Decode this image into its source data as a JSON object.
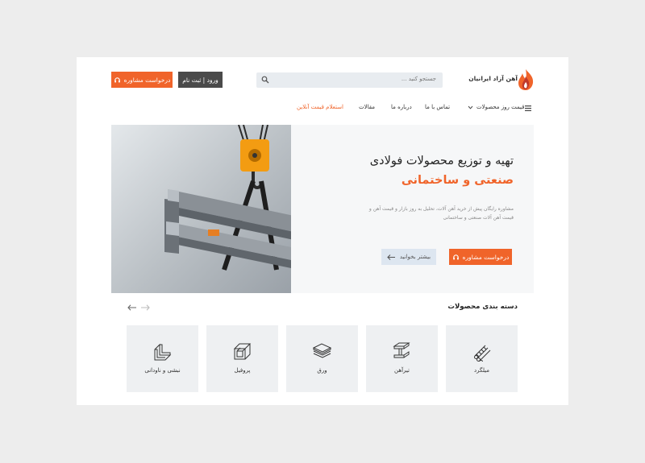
{
  "header": {
    "consult_button": "درخواست مشاوره",
    "login_button": "ورود | ثبت نام",
    "search_placeholder": "جستجو کنید ...",
    "brand": "آهن آزاد ایرانیان"
  },
  "nav": {
    "items": [
      "قیمت روز محصولات",
      "تماس با ما",
      "درباره ما",
      "مقالات",
      "استعلام قیمت آنلاین"
    ]
  },
  "hero": {
    "title_line1": "تهیه و توزیع محصولات فولادی",
    "title_line2": "صنعتی و ساختمانی",
    "description": "مشاوره رایگان پیش از خرید آهن آلات، تحلیل به روز بازار و قیمت آهن و قیمت آهن آلات صنعتی و ساختمانی",
    "consult_button": "درخواست مشاوره",
    "more_button": "بیشتر بخوانید"
  },
  "categories": {
    "title": "دسته بندی محصولات",
    "items": [
      {
        "label": "میلگرد",
        "icon": "rebar-icon"
      },
      {
        "label": "تیرآهن",
        "icon": "ibeam-icon"
      },
      {
        "label": "ورق",
        "icon": "sheet-icon"
      },
      {
        "label": "پروفیل",
        "icon": "profile-icon"
      },
      {
        "label": "نبشی و ناودانی",
        "icon": "angle-icon"
      }
    ]
  },
  "colors": {
    "accent": "#f0642a",
    "dark_button": "#4a4a4a",
    "light_button": "#dde6f0"
  }
}
